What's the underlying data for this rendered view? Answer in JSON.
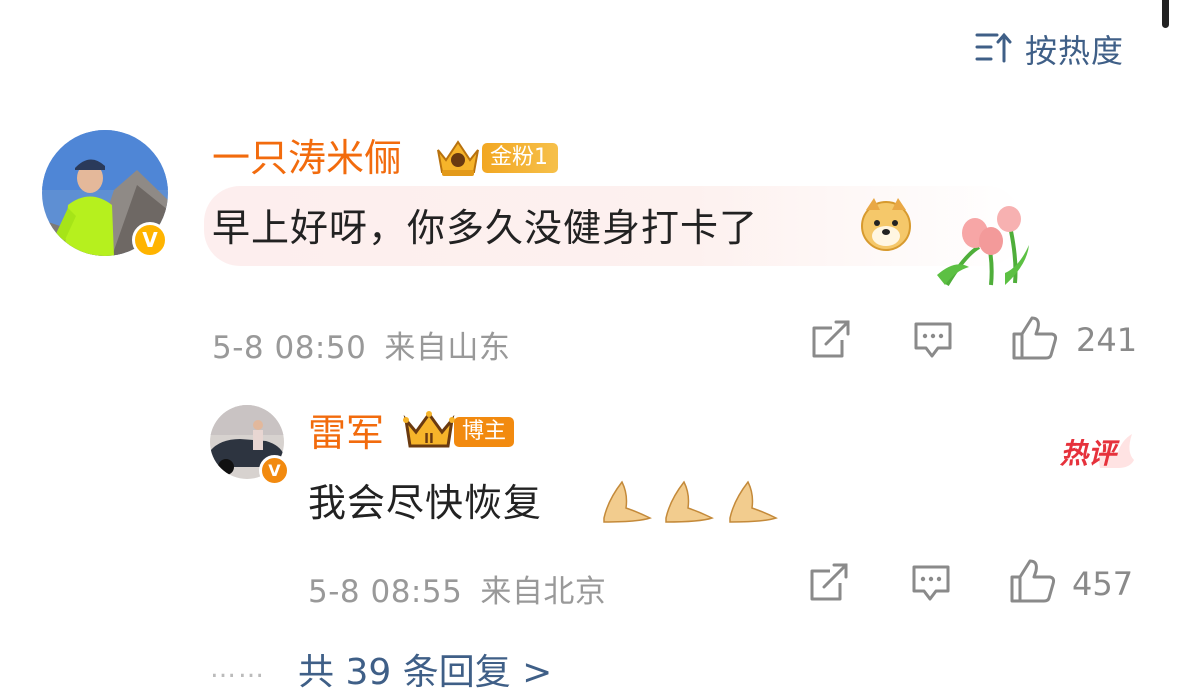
{
  "sort": {
    "label": "按热度",
    "icon": "sort-icon"
  },
  "comment": {
    "username": "一只涛米俪",
    "badge_label": "金粉1",
    "text": "早上好呀，你多久没健身打卡了",
    "time": "5-8 08:50",
    "location": "来自山东",
    "likes": "241"
  },
  "reply": {
    "username": "雷军",
    "badge_label": "博主",
    "text": "我会尽快恢复",
    "time": "5-8 08:55",
    "location": "来自北京",
    "likes": "457",
    "hot_tag": "热评"
  },
  "more": {
    "dots": "……",
    "label": "共 39 条回复 >"
  },
  "colors": {
    "username": "#f26b0d",
    "link": "#3f5f87",
    "meta": "#999999",
    "badge_gold": "#f6b42a",
    "vip": "#ffb400"
  }
}
